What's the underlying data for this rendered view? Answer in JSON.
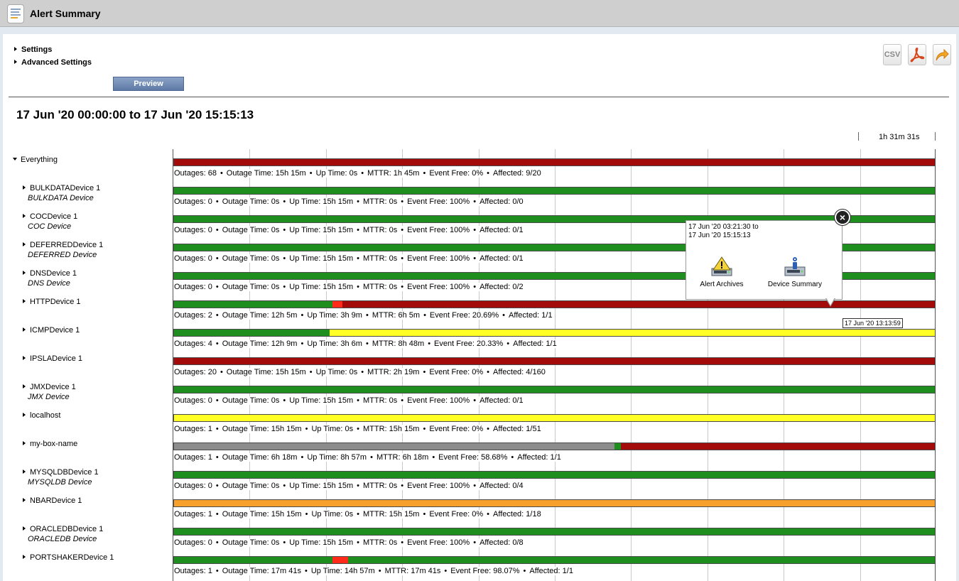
{
  "window": {
    "title": "Alert Summary"
  },
  "toggles": [
    {
      "label": "Settings"
    },
    {
      "label": "Advanced Settings"
    }
  ],
  "preview_label": "Preview",
  "export": {
    "csv_label": "CSV",
    "pdf_icon": "pdf-icon",
    "share_icon": "share-arrow-icon"
  },
  "date_range": "17 Jun '20 00:00:00 to 17 Jun '20 15:15:13",
  "scale_label": "1h 31m 31s",
  "colors": {
    "ok": "#1e8f1e",
    "critical": "#a30a0a",
    "warning": "#ffff26",
    "minor": "#f7a12c",
    "unknown": "#8c8c8c",
    "outage_red": "#ff2b1a"
  },
  "rows": [
    {
      "name": "Everything",
      "subtitle": "",
      "expanded": true,
      "segments": [
        {
          "from": 0,
          "to": 1,
          "status": "critical"
        }
      ],
      "stats": {
        "outages": "Outages: 68",
        "outage_time": "Outage Time: 15h 15m",
        "up_time": "Up Time: 0s",
        "mttr": "MTTR: 1h 45m",
        "event_free": "Event Free: 0%",
        "affected": "Affected: 9/20"
      }
    },
    {
      "name": "BULKDATADevice 1",
      "subtitle": "BULKDATA Device",
      "expanded": false,
      "segments": [
        {
          "from": 0,
          "to": 1,
          "status": "ok"
        }
      ],
      "stats": {
        "outages": "Outages: 0",
        "outage_time": "Outage Time: 0s",
        "up_time": "Up Time: 15h 15m",
        "mttr": "MTTR: 0s",
        "event_free": "Event Free: 100%",
        "affected": "Affected: 0/0"
      }
    },
    {
      "name": "COCDevice 1",
      "subtitle": "COC Device",
      "expanded": false,
      "segments": [
        {
          "from": 0,
          "to": 1,
          "status": "ok"
        }
      ],
      "stats": {
        "outages": "Outages: 0",
        "outage_time": "Outage Time: 0s",
        "up_time": "Up Time: 15h 15m",
        "mttr": "MTTR: 0s",
        "event_free": "Event Free: 100%",
        "affected": "Affected: 0/1"
      }
    },
    {
      "name": "DEFERREDDevice 1",
      "subtitle": "DEFERRED Device",
      "expanded": false,
      "segments": [
        {
          "from": 0,
          "to": 1,
          "status": "ok"
        }
      ],
      "stats": {
        "outages": "Outages: 0",
        "outage_time": "Outage Time: 0s",
        "up_time": "Up Time: 15h 15m",
        "mttr": "MTTR: 0s",
        "event_free": "Event Free: 100%",
        "affected": "Affected: 0/1"
      }
    },
    {
      "name": "DNSDevice 1",
      "subtitle": "DNS Device",
      "expanded": false,
      "segments": [
        {
          "from": 0,
          "to": 1,
          "status": "ok"
        }
      ],
      "stats": {
        "outages": "Outages: 0",
        "outage_time": "Outage Time: 0s",
        "up_time": "Up Time: 15h 15m",
        "mttr": "MTTR: 0s",
        "event_free": "Event Free: 100%",
        "affected": "Affected: 0/2"
      }
    },
    {
      "name": "HTTPDevice 1",
      "subtitle": "",
      "expanded": false,
      "segments": [
        {
          "from": 0,
          "to": 0.208,
          "status": "ok"
        },
        {
          "from": 0.208,
          "to": 0.221,
          "status": "outage_red"
        },
        {
          "from": 0.221,
          "to": 1,
          "status": "critical"
        }
      ],
      "stats": {
        "outages": "Outages: 2",
        "outage_time": "Outage Time: 12h 5m",
        "up_time": "Up Time: 3h 9m",
        "mttr": "MTTR: 6h 5m",
        "event_free": "Event Free: 20.69%",
        "affected": "Affected: 1/1"
      }
    },
    {
      "name": "ICMPDevice 1",
      "subtitle": "",
      "expanded": false,
      "segments": [
        {
          "from": 0,
          "to": 0.204,
          "status": "ok"
        },
        {
          "from": 0.204,
          "to": 1,
          "status": "warning"
        }
      ],
      "stats": {
        "outages": "Outages: 4",
        "outage_time": "Outage Time: 12h 9m",
        "up_time": "Up Time: 3h 6m",
        "mttr": "MTTR: 8h 48m",
        "event_free": "Event Free: 20.33%",
        "affected": "Affected: 1/1"
      }
    },
    {
      "name": "IPSLADevice 1",
      "subtitle": "",
      "expanded": false,
      "segments": [
        {
          "from": 0,
          "to": 1,
          "status": "critical"
        }
      ],
      "stats": {
        "outages": "Outages: 20",
        "outage_time": "Outage Time: 15h 15m",
        "up_time": "Up Time: 0s",
        "mttr": "MTTR: 2h 19m",
        "event_free": "Event Free: 0%",
        "affected": "Affected: 4/160"
      }
    },
    {
      "name": "JMXDevice 1",
      "subtitle": "JMX Device",
      "expanded": false,
      "segments": [
        {
          "from": 0,
          "to": 1,
          "status": "ok"
        }
      ],
      "stats": {
        "outages": "Outages: 0",
        "outage_time": "Outage Time: 0s",
        "up_time": "Up Time: 15h 15m",
        "mttr": "MTTR: 0s",
        "event_free": "Event Free: 100%",
        "affected": "Affected: 0/1"
      }
    },
    {
      "name": "localhost",
      "subtitle": "",
      "expanded": false,
      "segments": [
        {
          "from": 0,
          "to": 1,
          "status": "warning"
        }
      ],
      "stats": {
        "outages": "Outages: 1",
        "outage_time": "Outage Time: 15h 15m",
        "up_time": "Up Time: 0s",
        "mttr": "MTTR: 15h 15m",
        "event_free": "Event Free: 0%",
        "affected": "Affected: 1/51"
      }
    },
    {
      "name": "my-box-name",
      "subtitle": "",
      "expanded": false,
      "segments": [
        {
          "from": 0,
          "to": 0.578,
          "status": "unknown"
        },
        {
          "from": 0.578,
          "to": 0.586,
          "status": "ok"
        },
        {
          "from": 0.586,
          "to": 1,
          "status": "critical"
        }
      ],
      "stats": {
        "outages": "Outages: 1",
        "outage_time": "Outage Time: 6h 18m",
        "up_time": "Up Time: 8h 57m",
        "mttr": "MTTR: 6h 18m",
        "event_free": "Event Free: 58.68%",
        "affected": "Affected: 1/1"
      }
    },
    {
      "name": "MYSQLDBDevice 1",
      "subtitle": "MYSQLDB Device",
      "expanded": false,
      "segments": [
        {
          "from": 0,
          "to": 1,
          "status": "ok"
        }
      ],
      "stats": {
        "outages": "Outages: 0",
        "outage_time": "Outage Time: 0s",
        "up_time": "Up Time: 15h 15m",
        "mttr": "MTTR: 0s",
        "event_free": "Event Free: 100%",
        "affected": "Affected: 0/4"
      }
    },
    {
      "name": "NBARDevice 1",
      "subtitle": "",
      "expanded": false,
      "segments": [
        {
          "from": 0,
          "to": 1,
          "status": "minor"
        }
      ],
      "stats": {
        "outages": "Outages: 1",
        "outage_time": "Outage Time: 15h 15m",
        "up_time": "Up Time: 0s",
        "mttr": "MTTR: 15h 15m",
        "event_free": "Event Free: 0%",
        "affected": "Affected: 1/18"
      }
    },
    {
      "name": "ORACLEDBDevice 1",
      "subtitle": "ORACLEDB Device",
      "expanded": false,
      "segments": [
        {
          "from": 0,
          "to": 1,
          "status": "ok"
        }
      ],
      "stats": {
        "outages": "Outages: 0",
        "outage_time": "Outage Time: 0s",
        "up_time": "Up Time: 15h 15m",
        "mttr": "MTTR: 0s",
        "event_free": "Event Free: 100%",
        "affected": "Affected: 0/8"
      }
    },
    {
      "name": "PORTSHAKERDevice 1",
      "subtitle": "",
      "expanded": false,
      "segments": [
        {
          "from": 0,
          "to": 0.208,
          "status": "ok"
        },
        {
          "from": 0.208,
          "to": 0.228,
          "status": "outage_red"
        },
        {
          "from": 0.228,
          "to": 1,
          "status": "ok"
        }
      ],
      "stats": {
        "outages": "Outages: 1",
        "outage_time": "Outage Time: 17m 41s",
        "up_time": "Up Time: 14h 57m",
        "mttr": "MTTR: 17m 41s",
        "event_free": "Event Free: 98.07%",
        "affected": "Affected: 1/1"
      }
    }
  ],
  "popup": {
    "range_line1": "17 Jun '20 03:21:30 to",
    "range_line2": "17 Jun '20 15:15:13",
    "actions": [
      {
        "label": "Alert Archives",
        "icon": "alert-archives-icon"
      },
      {
        "label": "Device Summary",
        "icon": "device-summary-icon"
      }
    ],
    "close_icon": "close-icon"
  },
  "hover_time": "17 Jun '20 13:13:59"
}
